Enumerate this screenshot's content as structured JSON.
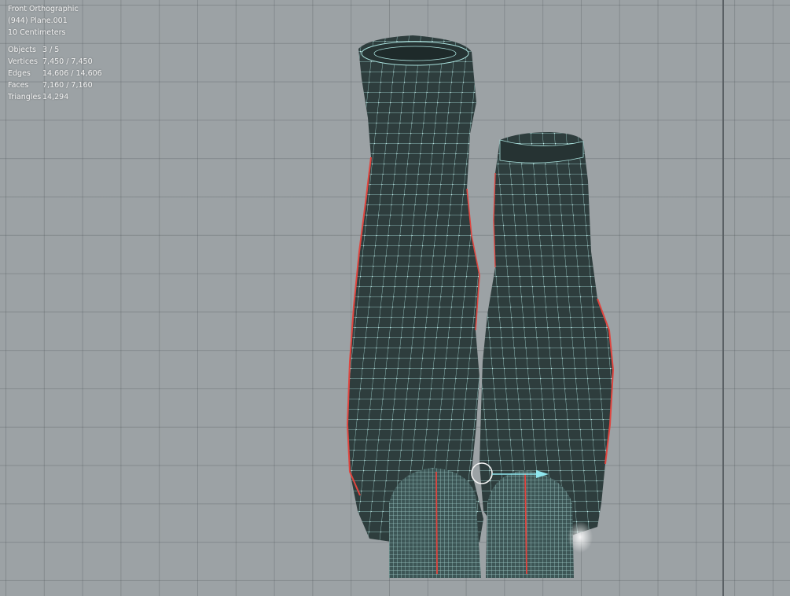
{
  "viewport": {
    "view_name": "Front Orthographic",
    "object_name": "(944) Plane.001",
    "grid_scale": "10 Centimeters"
  },
  "statistics": [
    {
      "label": "Objects",
      "value": "3 / 5"
    },
    {
      "label": "Vertices",
      "value": "7,450 / 7,450"
    },
    {
      "label": "Edges",
      "value": "14,606 / 14,606"
    },
    {
      "label": "Faces",
      "value": "7,160 / 7,160"
    },
    {
      "label": "Triangles",
      "value": "14,294"
    }
  ],
  "colors": {
    "background": "#9ca2a5",
    "grid": "#6b7276",
    "mesh_fill": "#2e3d3d",
    "wire": "#a9e0dc",
    "seam": "#e0453f",
    "text": "#f2f2f2"
  },
  "icons": [
    "3d-cursor-icon",
    "transform-arrow-icon"
  ]
}
